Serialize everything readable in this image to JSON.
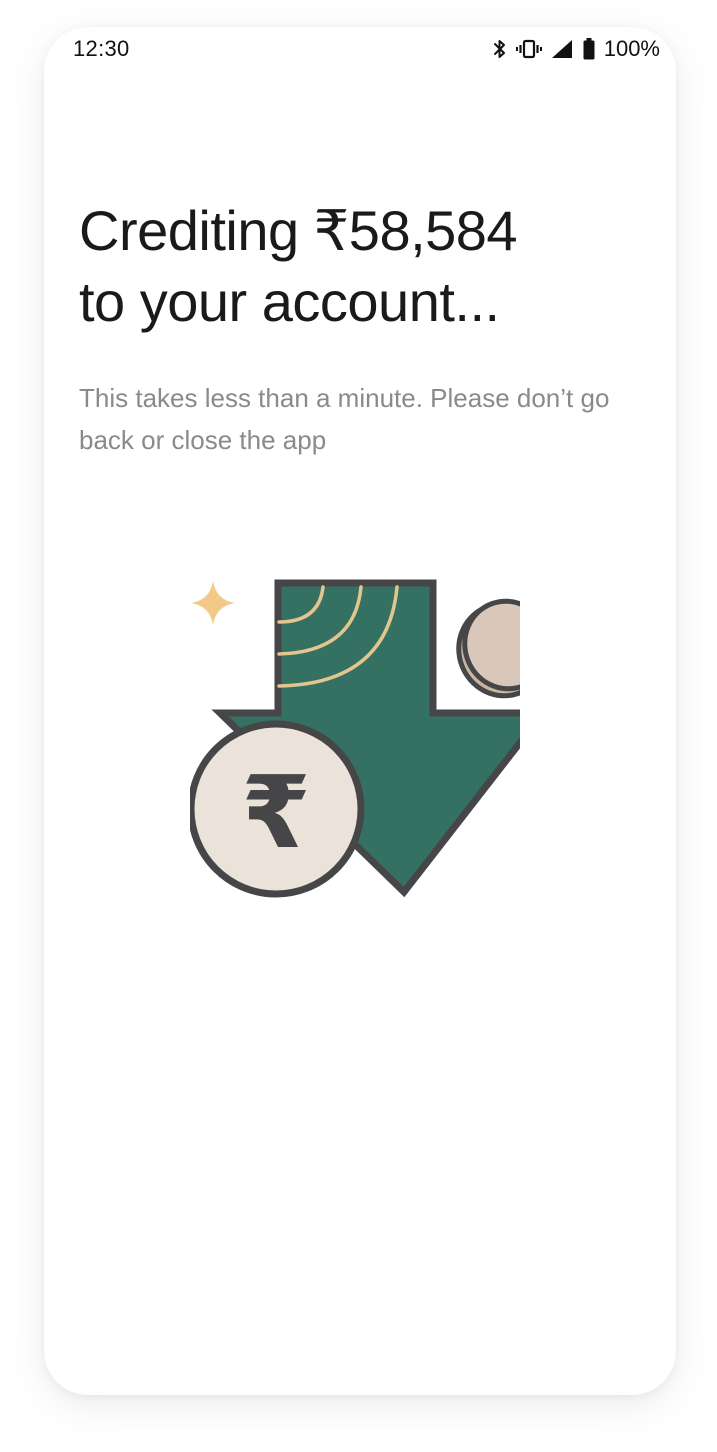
{
  "status_bar": {
    "time": "12:30",
    "battery": "100%",
    "icons": [
      "bluetooth-icon",
      "vibrate-icon",
      "signal-icon",
      "battery-icon"
    ]
  },
  "screen": {
    "title_line1": "Crediting ₹58,584",
    "title_line2": "to your account...",
    "subtitle": "This takes less than a minute. Please don’t go back or close the app"
  },
  "illustration": {
    "icons": [
      "arrow-down-icon",
      "rupee-coin-icon",
      "coin-icon",
      "sparkle-icon"
    ],
    "colors": {
      "arrow": "#357163",
      "outline": "#464648",
      "coin_face": "#ebe3da",
      "coin_small": "#d9c8b9",
      "lines": "#e2c58f",
      "sparkle": "#f2c987"
    }
  }
}
